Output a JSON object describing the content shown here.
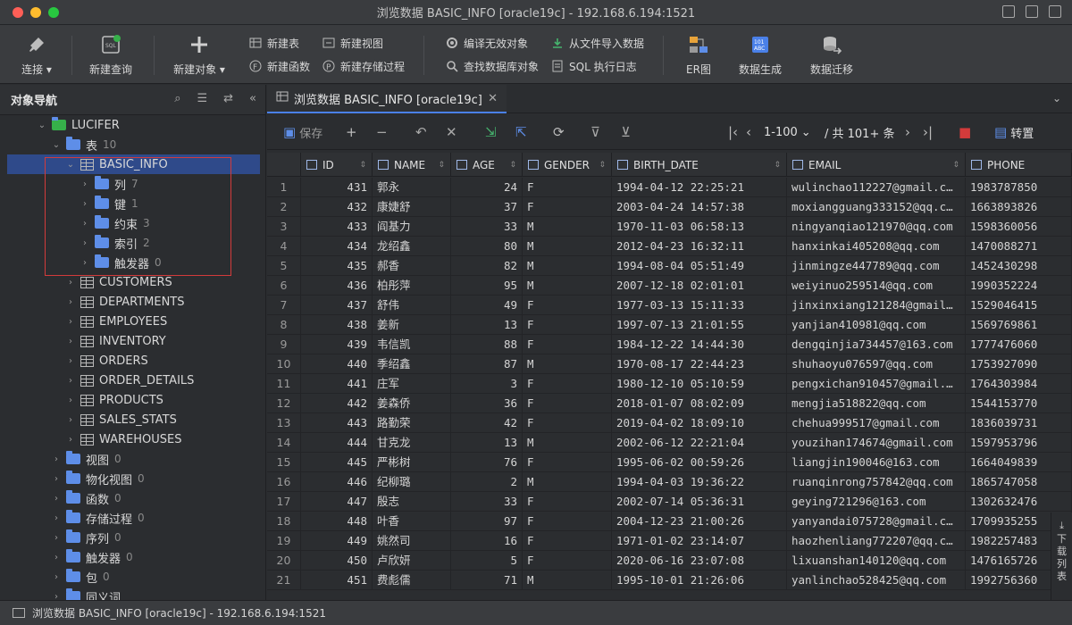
{
  "window": {
    "title": "浏览数据 BASIC_INFO [oracle19c] - 192.168.6.194:1521"
  },
  "toolbar": {
    "connect": "连接",
    "new_query": "新建查询",
    "new_object": "新建对象",
    "new_table": "新建表",
    "new_function": "新建函数",
    "new_view": "新建视图",
    "new_procedure": "新建存储过程",
    "compile_invalid": "编译无效对象",
    "find_objects": "查找数据库对象",
    "import_file": "从文件导入数据",
    "sql_log": "SQL 执行日志",
    "er": "ER图",
    "data_gen": "数据生成",
    "data_migrate": "数据迁移"
  },
  "nav": {
    "title": "对象导航",
    "tree": [
      {
        "label": "LUCIFER",
        "count": "",
        "level": 0,
        "kind": "schema",
        "expanded": true
      },
      {
        "label": "表",
        "count": "10",
        "level": 1,
        "kind": "folder",
        "expanded": true
      },
      {
        "label": "BASIC_INFO",
        "count": "",
        "level": 2,
        "kind": "table",
        "expanded": true,
        "selected": true
      },
      {
        "label": "列",
        "count": "7",
        "level": 3,
        "kind": "folder"
      },
      {
        "label": "键",
        "count": "1",
        "level": 3,
        "kind": "folder"
      },
      {
        "label": "约束",
        "count": "3",
        "level": 3,
        "kind": "folder"
      },
      {
        "label": "索引",
        "count": "2",
        "level": 3,
        "kind": "folder"
      },
      {
        "label": "触发器",
        "count": "0",
        "level": 3,
        "kind": "folder"
      },
      {
        "label": "CUSTOMERS",
        "count": "",
        "level": 2,
        "kind": "table"
      },
      {
        "label": "DEPARTMENTS",
        "count": "",
        "level": 2,
        "kind": "table"
      },
      {
        "label": "EMPLOYEES",
        "count": "",
        "level": 2,
        "kind": "table"
      },
      {
        "label": "INVENTORY",
        "count": "",
        "level": 2,
        "kind": "table"
      },
      {
        "label": "ORDERS",
        "count": "",
        "level": 2,
        "kind": "table"
      },
      {
        "label": "ORDER_DETAILS",
        "count": "",
        "level": 2,
        "kind": "table"
      },
      {
        "label": "PRODUCTS",
        "count": "",
        "level": 2,
        "kind": "table"
      },
      {
        "label": "SALES_STATS",
        "count": "",
        "level": 2,
        "kind": "table"
      },
      {
        "label": "WAREHOUSES",
        "count": "",
        "level": 2,
        "kind": "table"
      },
      {
        "label": "视图",
        "count": "0",
        "level": 1,
        "kind": "folder"
      },
      {
        "label": "物化视图",
        "count": "0",
        "level": 1,
        "kind": "folder"
      },
      {
        "label": "函数",
        "count": "0",
        "level": 1,
        "kind": "folder"
      },
      {
        "label": "存储过程",
        "count": "0",
        "level": 1,
        "kind": "folder"
      },
      {
        "label": "序列",
        "count": "0",
        "level": 1,
        "kind": "folder"
      },
      {
        "label": "触发器",
        "count": "0",
        "level": 1,
        "kind": "folder"
      },
      {
        "label": "包",
        "count": "0",
        "level": 1,
        "kind": "folder"
      },
      {
        "label": "同义词",
        "count": "",
        "level": 1,
        "kind": "folder"
      }
    ]
  },
  "tab": {
    "label": "浏览数据 BASIC_INFO [oracle19c]"
  },
  "gridbar": {
    "save": "保存",
    "range": "1-100",
    "total": "/ 共 101+ 条",
    "transpose": "转置"
  },
  "grid": {
    "columns": [
      "ID",
      "NAME",
      "AGE",
      "GENDER",
      "BIRTH_DATE",
      "EMAIL",
      "PHONE"
    ],
    "rows": [
      [
        "1",
        "431",
        "郭永",
        "24",
        "F",
        "1994-04-12 22:25:21",
        "wulinchao112227@gmail.c…",
        "1983787850"
      ],
      [
        "2",
        "432",
        "康婕舒",
        "37",
        "F",
        "2003-04-24 14:57:38",
        "moxiangguang333152@qq.c…",
        "1663893826"
      ],
      [
        "3",
        "433",
        "阎基力",
        "33",
        "M",
        "1970-11-03 06:58:13",
        "ningyanqiao121970@qq.com",
        "1598360056"
      ],
      [
        "4",
        "434",
        "龙绍鑫",
        "80",
        "M",
        "2012-04-23 16:32:11",
        "hanxinkai405208@qq.com",
        "1470088271"
      ],
      [
        "5",
        "435",
        "郝香",
        "82",
        "M",
        "1994-08-04 05:51:49",
        "jinmingze447789@qq.com",
        "1452430298"
      ],
      [
        "6",
        "436",
        "柏彤萍",
        "95",
        "M",
        "2007-12-18 02:01:01",
        "weiyinuo259514@qq.com",
        "1990352224"
      ],
      [
        "7",
        "437",
        "舒伟",
        "49",
        "F",
        "1977-03-13 15:11:33",
        "jinxinxiang121284@gmail…",
        "1529046415"
      ],
      [
        "8",
        "438",
        "姜新",
        "13",
        "F",
        "1997-07-13 21:01:55",
        "yanjian410981@qq.com",
        "1569769861"
      ],
      [
        "9",
        "439",
        "韦信凯",
        "88",
        "F",
        "1984-12-22 14:44:30",
        "dengqinjia734457@163.com",
        "1777476060"
      ],
      [
        "10",
        "440",
        "季绍鑫",
        "87",
        "M",
        "1970-08-17 22:44:23",
        "shuhaoyu076597@qq.com",
        "1753927090"
      ],
      [
        "11",
        "441",
        "庄军",
        "3",
        "F",
        "1980-12-10 05:10:59",
        "pengxichan910457@gmail.…",
        "1764303984"
      ],
      [
        "12",
        "442",
        "姜森侨",
        "36",
        "F",
        "2018-01-07 08:02:09",
        "mengjia518822@qq.com",
        "1544153770"
      ],
      [
        "13",
        "443",
        "路勤荣",
        "42",
        "F",
        "2019-04-02 18:09:10",
        "chehua999517@gmail.com",
        "1836039731"
      ],
      [
        "14",
        "444",
        "甘克龙",
        "13",
        "M",
        "2002-06-12 22:21:04",
        "youzihan174674@gmail.com",
        "1597953796"
      ],
      [
        "15",
        "445",
        "严彬树",
        "76",
        "F",
        "1995-06-02 00:59:26",
        "liangjin190046@163.com",
        "1664049839"
      ],
      [
        "16",
        "446",
        "纪柳璐",
        "2",
        "M",
        "1994-04-03 19:36:22",
        "ruanqinrong757842@qq.com",
        "1865747058"
      ],
      [
        "17",
        "447",
        "殷志",
        "33",
        "F",
        "2002-07-14 05:36:31",
        "geying721296@163.com",
        "1302632476"
      ],
      [
        "18",
        "448",
        "叶香",
        "97",
        "F",
        "2004-12-23 21:00:26",
        "yanyandai075728@gmail.c…",
        "1709935255"
      ],
      [
        "19",
        "449",
        "姚然司",
        "16",
        "F",
        "1971-01-02 23:14:07",
        "haozhenliang772207@qq.c…",
        "1982257483"
      ],
      [
        "20",
        "450",
        "卢欣妍",
        "5",
        "F",
        "2020-06-16 23:07:08",
        "lixuanshan140120@qq.com",
        "1476165726"
      ],
      [
        "21",
        "451",
        "费彪儒",
        "71",
        "M",
        "1995-10-01 21:26:06",
        "yanlinchao528425@qq.com",
        "1992756360"
      ]
    ]
  },
  "side": {
    "download_list": "下载列表"
  },
  "status": {
    "text": "浏览数据 BASIC_INFO [oracle19c] - 192.168.6.194:1521"
  },
  "colors": {
    "accent": "#4a80e8",
    "selection": "#2f4a8a",
    "folder": "#5e8ee8",
    "highlight_box": "#d33b3b"
  }
}
